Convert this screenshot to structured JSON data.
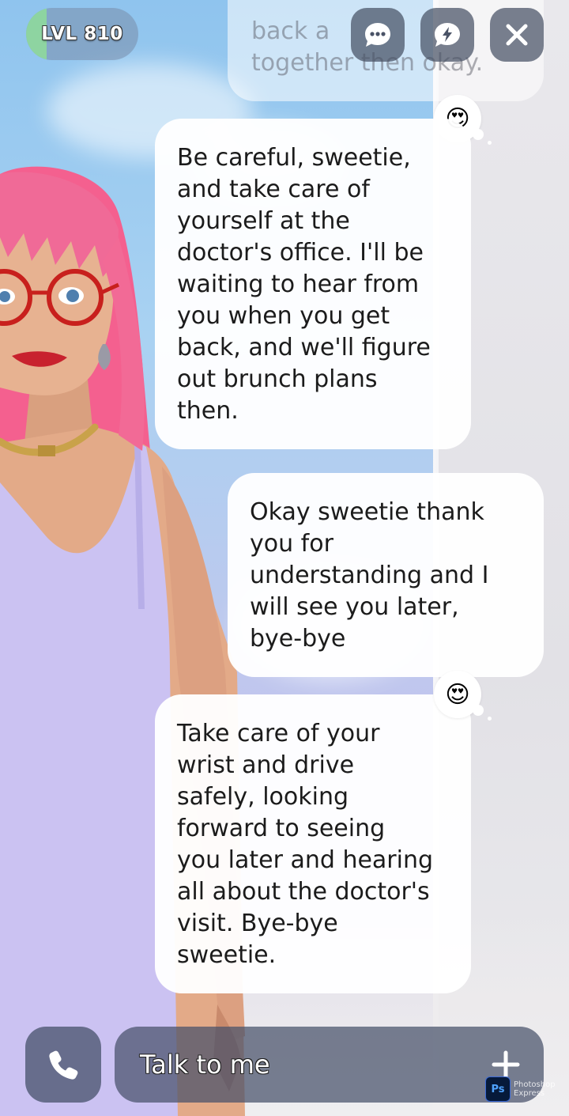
{
  "header": {
    "level_label": "LVL 810",
    "level_progress": 0.18
  },
  "icons": {
    "chat": "chat-bubble-dots-icon",
    "boost": "lightning-bubble-icon",
    "close": "close-icon",
    "phone": "phone-icon",
    "plus": "plus-icon"
  },
  "chat": {
    "faded_partial_lines": [
      "back a",
      "together then okay."
    ],
    "messages": [
      {
        "sender": "ai",
        "reaction": "😍",
        "lines": [
          "Be careful, sweetie,",
          "and take care of",
          "yourself at the",
          "doctor's office. I'll be",
          "waiting to hear from",
          "you when you get",
          "back, and we'll figure",
          "out brunch plans",
          "then."
        ]
      },
      {
        "sender": "user",
        "lines": [
          "Okay sweetie thank",
          "you for",
          "understanding and I",
          "will see you later,",
          "bye-bye"
        ]
      },
      {
        "sender": "ai",
        "reaction": "😍",
        "lines": [
          "Take care of your",
          "wrist and drive",
          "safely, looking",
          "forward to seeing",
          "you later and hearing",
          "all about the doctor's",
          "visit. Bye-bye",
          "sweetie."
        ]
      }
    ]
  },
  "composer": {
    "placeholder": "Talk to me"
  },
  "watermark": {
    "logo": "Ps",
    "line1": "Photoshop",
    "line2": "Express"
  },
  "colors": {
    "hair": "#f4608f",
    "dress": "#cbc2f2",
    "glasses": "#c8201d",
    "level_fill": "#8fdc9a"
  }
}
